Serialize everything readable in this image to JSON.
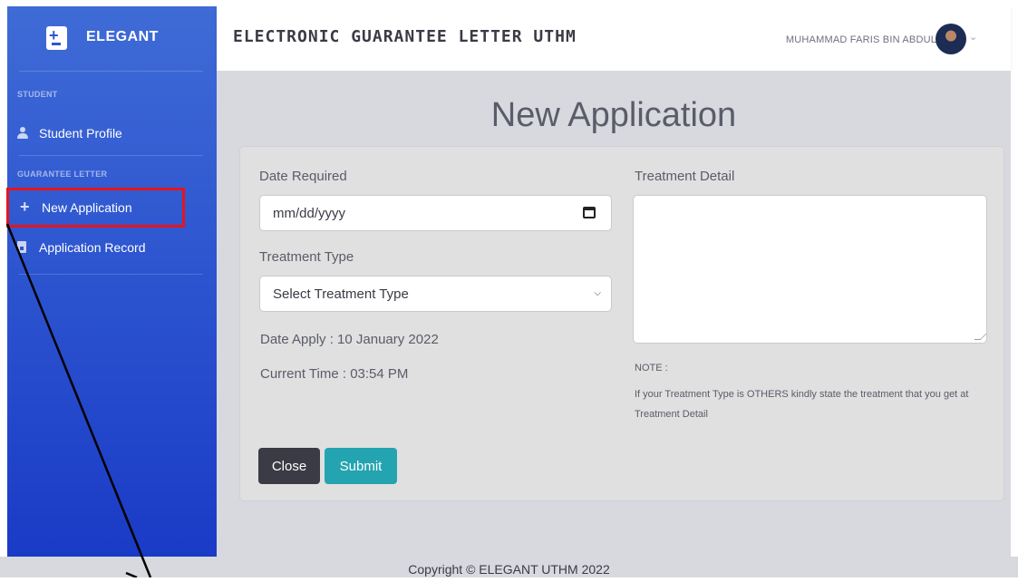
{
  "brand": {
    "name": "ELEGANT"
  },
  "sidebar": {
    "sections": [
      {
        "heading": "STUDENT",
        "items": [
          {
            "label": "Student Profile",
            "icon": "user-icon"
          }
        ]
      },
      {
        "heading": "GUARANTEE LETTER",
        "items": [
          {
            "label": "New Application",
            "icon": "plus-icon",
            "highlighted": true
          },
          {
            "label": "Application Record",
            "icon": "file-icon"
          }
        ]
      }
    ]
  },
  "header": {
    "app_title": "ELECTRONIC GUARANTEE LETTER UTHM",
    "user_name": "MUHAMMAD FARIS BIN ABDUL HADI"
  },
  "main": {
    "page_title": "New Application",
    "form": {
      "date_required_label": "Date Required",
      "date_placeholder": "mm/dd/yyyy",
      "treatment_type_label": "Treatment Type",
      "treatment_type_selected": "Select Treatment Type",
      "date_apply": "Date Apply : 10 January 2022",
      "current_time": "Current Time : 03:54 PM",
      "treatment_detail_label": "Treatment Detail",
      "treatment_detail_value": "",
      "note_label": "NOTE :",
      "note_text": "If your Treatment Type is OTHERS kindly state the treatment that you get at Treatment Detail",
      "close_label": "Close",
      "submit_label": "Submit"
    }
  },
  "footer": {
    "copyright": "Copyright © ELEGANT UTHM 2022"
  },
  "colors": {
    "sidebar_top": "#3f6bd6",
    "sidebar_bottom": "#1a3bc6",
    "highlight_box": "#e8141b",
    "close_button": "#3a3b45",
    "submit_button": "#24a4b0",
    "content_background": "#d7d9de"
  }
}
